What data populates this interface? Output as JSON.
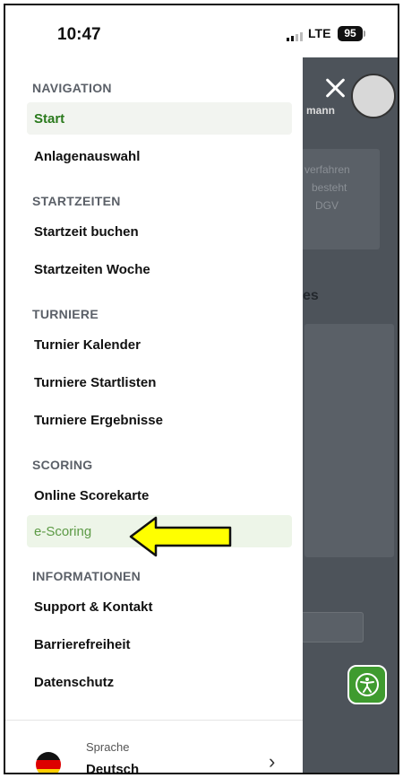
{
  "status_bar": {
    "time": "10:47",
    "network": "LTE",
    "battery": "95"
  },
  "drawer": {
    "sections": [
      {
        "header": "NAVIGATION",
        "items": [
          {
            "label": "Start",
            "state": "active"
          },
          {
            "label": "Anlagenauswahl"
          }
        ]
      },
      {
        "header": "STARTZEITEN",
        "items": [
          {
            "label": "Startzeit buchen"
          },
          {
            "label": "Startzeiten Woche"
          }
        ]
      },
      {
        "header": "TURNIERE",
        "items": [
          {
            "label": "Turnier Kalender"
          },
          {
            "label": "Turniere Startlisten"
          },
          {
            "label": "Turniere Ergebnisse"
          }
        ]
      },
      {
        "header": "SCORING",
        "items": [
          {
            "label": "Online Scorekarte"
          },
          {
            "label": "e-Scoring",
            "state": "highlighted"
          }
        ]
      },
      {
        "header": "INFORMATIONEN",
        "items": [
          {
            "label": "Support & Kontakt"
          },
          {
            "label": "Barrierefreiheit"
          },
          {
            "label": "Datenschutz"
          }
        ]
      }
    ],
    "language": {
      "caption": "Sprache",
      "value": "Deutsch"
    }
  },
  "background": {
    "profile_name_fragment": "mann",
    "card_text_lines": [
      "verfahren",
      "besteht",
      "DGV"
    ],
    "section_fragment": "es"
  },
  "colors": {
    "accent_green": "#3f9b2f",
    "active_text": "#2b7a1d",
    "highlight_bg": "#edf5e8",
    "arrow_fill": "#ffff00"
  },
  "icons": {
    "close": "close-icon",
    "accessibility": "accessibility-icon",
    "language_flag": "german-flag-icon",
    "chevron": "chevron-right-icon",
    "annotation_arrow": "left-arrow-annotation"
  }
}
